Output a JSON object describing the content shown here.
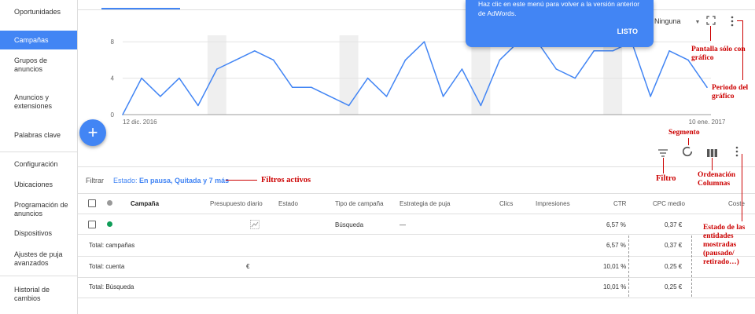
{
  "sidebar": {
    "items": [
      {
        "label": "Oportunidades",
        "active": false
      },
      {
        "label": "Campañas",
        "active": true
      },
      {
        "label": "Grupos de anuncios",
        "active": false
      },
      {
        "label": "Anuncios y extensiones",
        "active": false
      },
      {
        "label": "Palabras clave",
        "active": false
      },
      {
        "label": "Configuración",
        "active": false
      },
      {
        "label": "Ubicaciones",
        "active": false
      },
      {
        "label": "Programación de anuncios",
        "active": false
      },
      {
        "label": "Dispositivos",
        "active": false
      },
      {
        "label": "Ajustes de puja avanzados",
        "active": false
      },
      {
        "label": "Historial de cambios",
        "active": false
      }
    ]
  },
  "chart": {
    "segment_select": "Ninguna",
    "accent_color": "#4285f4"
  },
  "chart_data": {
    "type": "line",
    "yticks": [
      "0",
      "4",
      "8"
    ],
    "ylim": [
      0,
      10
    ],
    "xtick_labels": [
      "12 dic. 2016",
      "10 ene. 2017"
    ],
    "grid": true,
    "values": [
      0,
      4,
      2,
      4,
      1,
      5,
      6,
      7,
      6,
      3,
      3,
      2,
      1,
      4,
      2,
      6,
      8,
      2,
      5,
      1,
      6,
      8,
      8,
      5,
      4,
      7,
      7,
      8,
      2,
      7,
      6,
      3
    ]
  },
  "tooltip": {
    "text": "Haz clic en este menú para volver a la versión anterior de AdWords.",
    "button": "LISTO"
  },
  "filters": {
    "label": "Filtrar",
    "prefix": "Estado:",
    "value": "En pausa, Quitada y 7 más"
  },
  "table": {
    "headers": {
      "campaign": "Campaña",
      "budget": "Presupuesto diario",
      "status": "Estado",
      "type": "Tipo de campaña",
      "bid": "Estrategia de puja",
      "clicks": "Clics",
      "impressions": "Impresiones",
      "ctr": "CTR",
      "cpc": "CPC medio",
      "cost": "Coste"
    },
    "campaign_row": {
      "type": "Búsqueda",
      "bid": "—",
      "ctr": "6,57 %",
      "cpc": "0,37 €"
    },
    "totals": [
      {
        "label": "Total: campañas",
        "budget": "",
        "ctr": "6,57 %",
        "cpc": "0,37 €"
      },
      {
        "label": "Total: cuenta",
        "budget": "€",
        "ctr": "10,01 %",
        "cpc": "0,25 €"
      },
      {
        "label": "Total: Búsqueda",
        "budget": "",
        "ctr": "10,01 %",
        "cpc": "0,25 €"
      }
    ]
  },
  "annotations": {
    "fullscreen": "Pantalla sólo con gráfico",
    "period": "Periodo del gráfico",
    "segment": "Segmento",
    "filters_active": "Filtros activos",
    "filter": "Filtro",
    "columns": "Ordenación Columnas",
    "status": "Estado de las entidades mostradas (pausado/ retirado…)",
    "color": "#cc0000"
  }
}
